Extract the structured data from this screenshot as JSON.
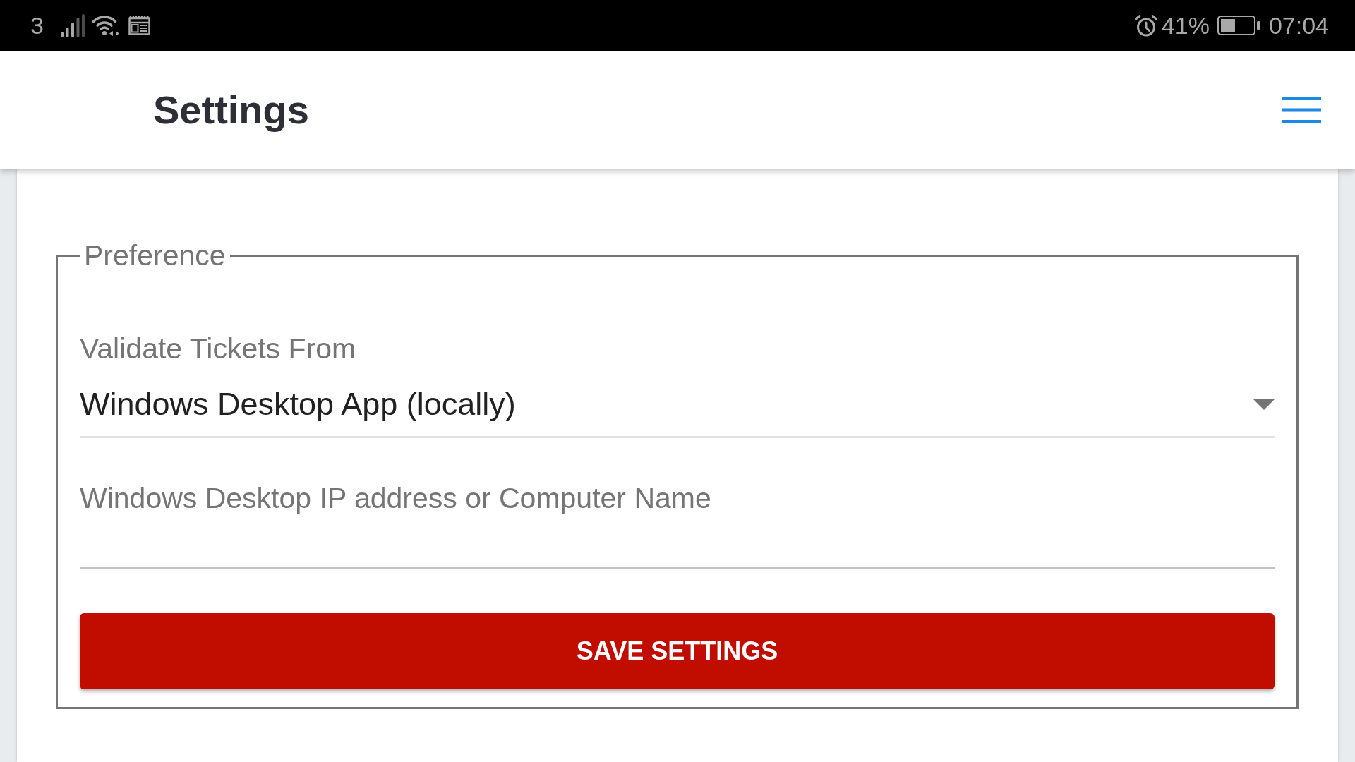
{
  "status_bar": {
    "carrier": "3",
    "battery": "41%",
    "time": "07:04"
  },
  "header": {
    "title": "Settings"
  },
  "preference": {
    "legend": "Preference",
    "fields": [
      {
        "kind": "select",
        "label": "Validate Tickets From",
        "value": "Windows Desktop App (locally)"
      },
      {
        "kind": "text",
        "placeholder": "Windows Desktop IP address or Computer Name"
      }
    ],
    "save_button": "SAVE SETTINGS"
  }
}
